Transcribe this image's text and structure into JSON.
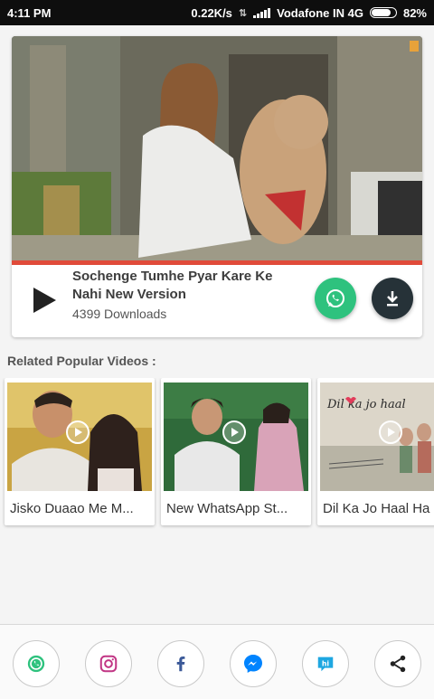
{
  "status_bar": {
    "time": "4:11 PM",
    "network_speed": "0.22K/s",
    "carrier": "Vodafone IN 4G",
    "battery": "82%",
    "battery_level": 0.82
  },
  "main_video": {
    "title": "Sochenge Tumhe Pyar Kare Ke Nahi New Version",
    "downloads": "4399 Downloads",
    "progress": 1.0,
    "progress_color": "#e04b3a",
    "play_icon": "play-icon",
    "whatsapp_button_color": "#2ec27e",
    "download_button_color": "#263238"
  },
  "related": {
    "title": "Related Popular Videos :",
    "items": [
      {
        "label": "Jisko Duaao Me M..."
      },
      {
        "label": "New WhatsApp St..."
      },
      {
        "label": "Dil Ka Jo Haal Ha"
      }
    ],
    "overlay_text": "Dil ka jo haal"
  },
  "share_bar": {
    "buttons": [
      {
        "icon": "whatsapp-icon",
        "color": "#2ec27e"
      },
      {
        "icon": "instagram-icon",
        "color": "#c13584"
      },
      {
        "icon": "facebook-icon",
        "color": "#3b5998"
      },
      {
        "icon": "messenger-icon",
        "color": "#0084ff"
      },
      {
        "icon": "hike-icon",
        "color": "#1ea7e1"
      },
      {
        "icon": "share-icon",
        "color": "#222222"
      }
    ]
  }
}
